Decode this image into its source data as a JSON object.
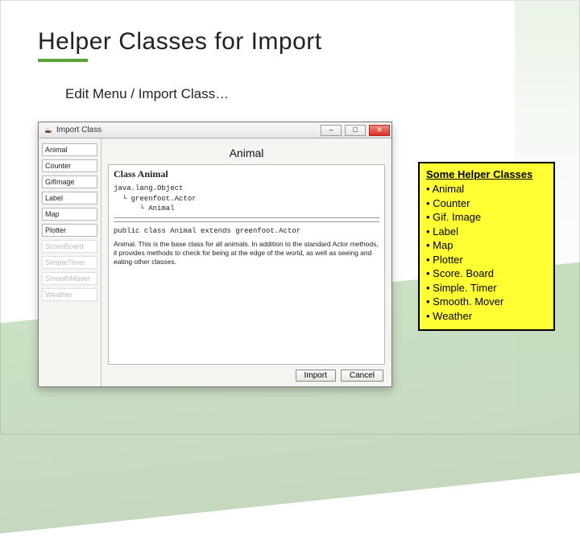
{
  "slide": {
    "title": "Helper Classes for Import",
    "subtitle": "Edit Menu / Import Class…"
  },
  "dialog": {
    "window_title": "Import Class",
    "sidebar_items": [
      {
        "label": "Animal",
        "faded": false
      },
      {
        "label": "Counter",
        "faded": false
      },
      {
        "label": "GifImage",
        "faded": false
      },
      {
        "label": "Label",
        "faded": false
      },
      {
        "label": "Map",
        "faded": false
      },
      {
        "label": "Plotter",
        "faded": false
      },
      {
        "label": "ScoreBoard",
        "faded": true
      },
      {
        "label": "SimpleTimer",
        "faded": true
      },
      {
        "label": "SmoothMover",
        "faded": true
      },
      {
        "label": "Weather",
        "faded": true
      }
    ],
    "selected_title": "Animal",
    "doc": {
      "heading": "Class Animal",
      "tree": "java.lang.Object\n  └ greenfoot.Actor\n      └ Animal",
      "signature": "public class Animal extends greenfoot.Actor",
      "description": "Animal. This is the base class for all animals. In addition to the standard Actor methods, it provides methods to check for being at the edge of the world, as well as seeing and eating other classes."
    },
    "buttons": {
      "import": "Import",
      "cancel": "Cancel"
    }
  },
  "helper_box": {
    "title": "Some Helper Classes",
    "items": [
      "Animal",
      "Counter",
      "Gif. Image",
      "Label",
      "Map",
      "Plotter",
      "Score. Board",
      "Simple. Timer",
      "Smooth. Mover",
      "Weather"
    ]
  }
}
